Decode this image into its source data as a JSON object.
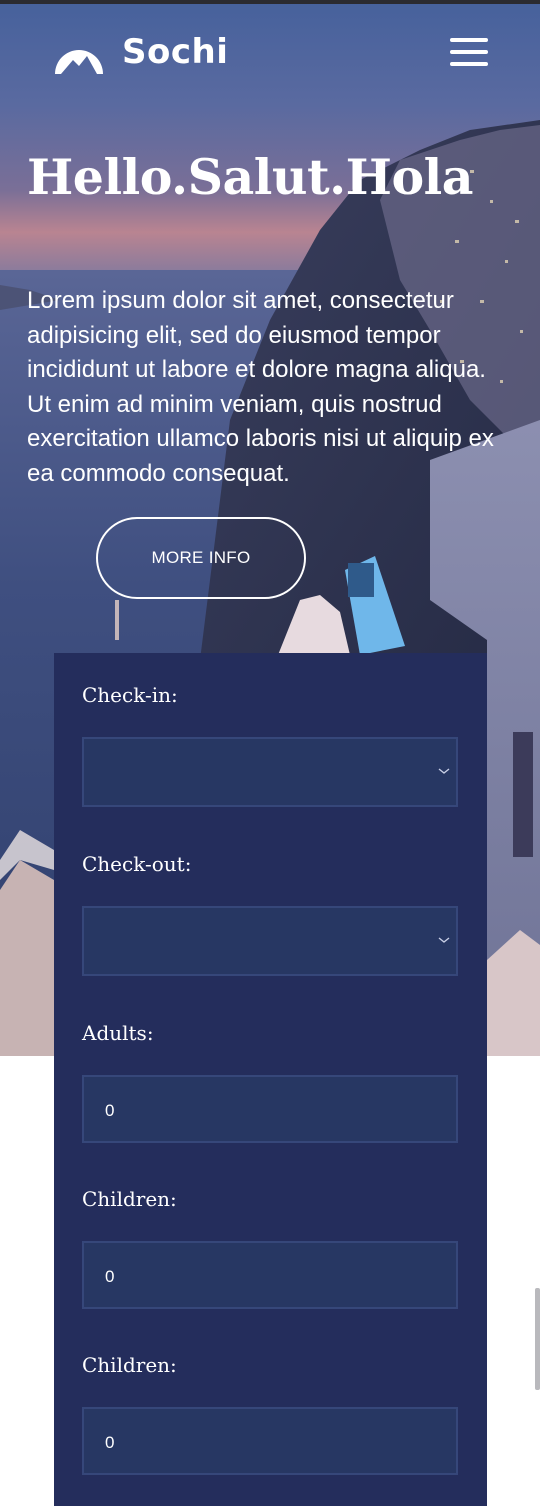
{
  "brand": {
    "name": "Sochi"
  },
  "hero": {
    "title": "Hello.Salut.Hola",
    "text": "Lorem ipsum dolor sit amet, consectetur adipisicing elit, sed do eiusmod tempor incididunt ut labore et dolore magna aliqua. Ut enim ad minim veniam, quis nostrud exercitation ullamco laboris nisi ut aliquip ex ea commodo consequat.",
    "button_label": "MORE INFO"
  },
  "booking": {
    "checkin": {
      "label": "Check-in:",
      "value": ""
    },
    "checkout": {
      "label": "Check-out:",
      "value": ""
    },
    "adults": {
      "label": "Adults:",
      "value": "0"
    },
    "children": {
      "label": "Children:",
      "value": "0"
    },
    "children2": {
      "label": "Children:",
      "value": "0"
    }
  },
  "colors": {
    "panel": "#242d5c",
    "field": "#273763",
    "field_border": "#36477a",
    "text": "#ffffff"
  }
}
